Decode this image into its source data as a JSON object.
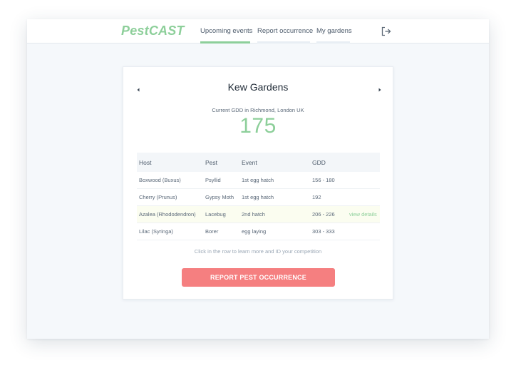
{
  "app": {
    "logo": "PestCAST",
    "accent_color": "#8dcf9a",
    "danger_color": "#f57f80"
  },
  "nav": {
    "tabs": [
      {
        "label": "Upcoming events",
        "active": true
      },
      {
        "label": "Report occurrence",
        "active": false
      },
      {
        "label": "My gardens",
        "active": false
      }
    ],
    "logout_icon": "logout-icon"
  },
  "garden": {
    "name": "Kew Gardens",
    "gdd_caption": "Current GDD in Richmond, London UK",
    "gdd_value": "175"
  },
  "table": {
    "headers": [
      "Host",
      "Pest",
      "Event",
      "GDD"
    ],
    "rows": [
      {
        "host": "Boxwood (Buxus)",
        "pest": "Psyllid",
        "event": "1st egg hatch",
        "gdd": "156 - 180",
        "action": ""
      },
      {
        "host": "Cherry (Prunus)",
        "pest": "Gypsy Moth",
        "event": "1st egg hatch",
        "gdd": "192",
        "action": ""
      },
      {
        "host": "Azalea (Rhododendron)",
        "pest": "Lacebug",
        "event": "2nd hatch",
        "gdd": "206 - 226",
        "action": "view details"
      },
      {
        "host": "Lilac (Syringa)",
        "pest": "Borer",
        "event": "egg laying",
        "gdd": "303 - 333",
        "action": ""
      }
    ]
  },
  "hint": "Click in the row to learn more and ID your competition",
  "report_button": "REPORT PEST OCCURRENCE"
}
